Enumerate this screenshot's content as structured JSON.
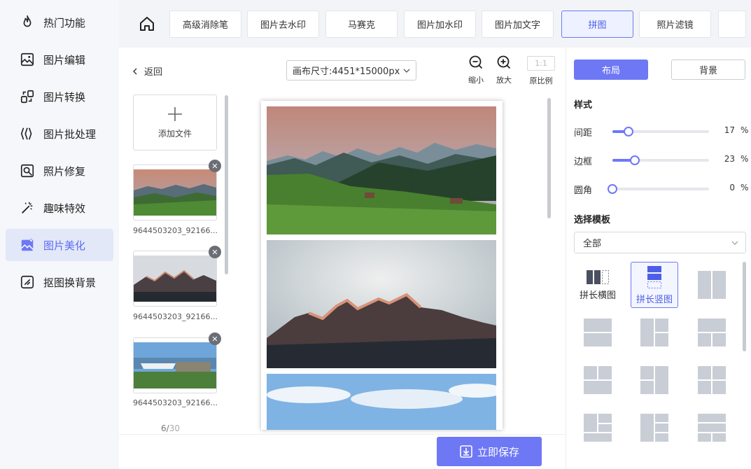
{
  "sidebar": {
    "items": [
      {
        "label": "热门功能",
        "icon": "fire-icon"
      },
      {
        "label": "图片编辑",
        "icon": "image-edit-icon"
      },
      {
        "label": "图片转换",
        "icon": "convert-icon"
      },
      {
        "label": "图片批处理",
        "icon": "batch-icon"
      },
      {
        "label": "照片修复",
        "icon": "photo-repair-icon"
      },
      {
        "label": "趣味特效",
        "icon": "magic-wand-icon"
      },
      {
        "label": "图片美化",
        "icon": "beautify-icon",
        "active": true
      },
      {
        "label": "抠图换背景",
        "icon": "cutout-icon"
      }
    ]
  },
  "tabs": [
    {
      "label": "高级消除笔"
    },
    {
      "label": "图片去水印"
    },
    {
      "label": "马赛克"
    },
    {
      "label": "图片加水印"
    },
    {
      "label": "图片加文字"
    },
    {
      "label": "拼图",
      "active": true
    },
    {
      "label": "照片滤镜"
    }
  ],
  "files": {
    "back_label": "返回",
    "add_label": "添加文件",
    "items": [
      {
        "name": "9644503203_92166..."
      },
      {
        "name": "9644503203_92166..."
      },
      {
        "name": "9644503203_92166..."
      }
    ],
    "page_current": "6/",
    "page_total": "30"
  },
  "canvas": {
    "size_label": "画布尺寸:4451*15000px",
    "zoom_out_label": "缩小",
    "zoom_in_label": "放大",
    "ratio_value": "1:1",
    "ratio_label": "原比例"
  },
  "save_label": "立即保存",
  "panel": {
    "tab_layout": "布局",
    "tab_background": "背景",
    "style_title": "样式",
    "sliders": [
      {
        "label": "间距",
        "value": 17,
        "unit": "%"
      },
      {
        "label": "边框",
        "value": 23,
        "unit": "%"
      },
      {
        "label": "圆角",
        "value": 0,
        "unit": "%"
      }
    ],
    "template_title": "选择模板",
    "template_filter": "全部",
    "templates": [
      {
        "label": "拼长横图"
      },
      {
        "label": "拼长竖图",
        "selected": true
      }
    ]
  },
  "colors": {
    "accent": "#6e78f5",
    "active_text": "#4d5fe6",
    "template_gray": "#c9cdd5"
  }
}
